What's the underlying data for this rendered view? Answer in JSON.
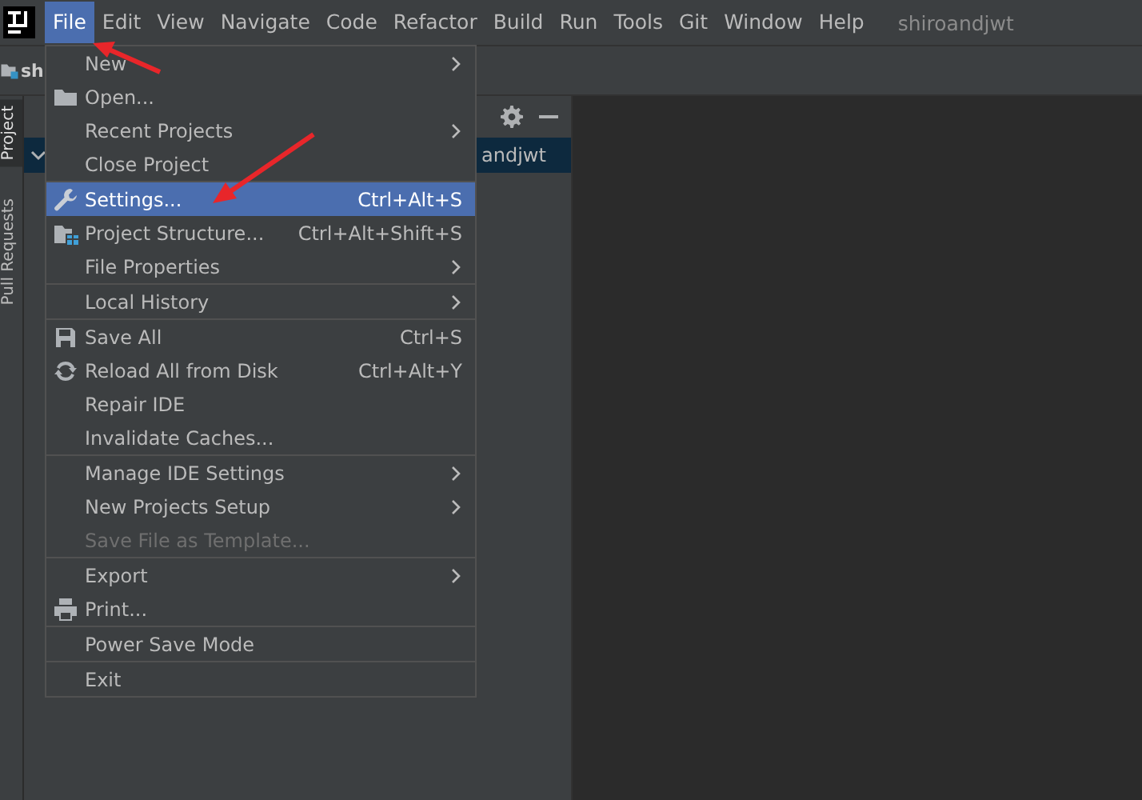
{
  "menubar": {
    "items": [
      {
        "label": "File",
        "selected": true
      },
      {
        "label": "Edit",
        "selected": false
      },
      {
        "label": "View",
        "selected": false
      },
      {
        "label": "Navigate",
        "selected": false
      },
      {
        "label": "Code",
        "selected": false
      },
      {
        "label": "Refactor",
        "selected": false
      },
      {
        "label": "Build",
        "selected": false
      },
      {
        "label": "Run",
        "selected": false
      },
      {
        "label": "Tools",
        "selected": false
      },
      {
        "label": "Git",
        "selected": false
      },
      {
        "label": "Window",
        "selected": false
      },
      {
        "label": "Help",
        "selected": false
      }
    ],
    "project_title": "shiroandjwt"
  },
  "tool_strip": [
    {
      "label": "Project",
      "selected": true
    },
    {
      "label": "Pull Requests",
      "selected": false
    }
  ],
  "breadcrumb": "sh",
  "project_tree": {
    "rows": [
      {
        "label": "andjwt",
        "expanded": true,
        "selected": true
      }
    ]
  },
  "file_menu": {
    "groups": [
      [
        {
          "label": "New",
          "kind": "plain",
          "submenu": true,
          "selected": false,
          "disabled": false
        },
        {
          "label": "Open...",
          "kind": "open",
          "submenu": false,
          "selected": false,
          "disabled": false
        },
        {
          "label": "Recent Projects",
          "kind": "plain",
          "submenu": true,
          "selected": false,
          "disabled": false
        },
        {
          "label": "Close Project",
          "kind": "plain",
          "submenu": false,
          "selected": false,
          "disabled": false
        }
      ],
      [
        {
          "label": "Settings...",
          "kind": "settings",
          "shortcut": "Ctrl+Alt+S",
          "submenu": false,
          "selected": true,
          "disabled": false
        },
        {
          "label": "Project Structure...",
          "kind": "structure",
          "shortcut": "Ctrl+Alt+Shift+S",
          "submenu": false,
          "selected": false,
          "disabled": false
        },
        {
          "label": "File Properties",
          "kind": "plain",
          "submenu": true,
          "selected": false,
          "disabled": false
        }
      ],
      [
        {
          "label": "Local History",
          "kind": "plain",
          "submenu": true,
          "selected": false,
          "disabled": false
        }
      ],
      [
        {
          "label": "Save All",
          "kind": "save",
          "shortcut": "Ctrl+S",
          "submenu": false,
          "selected": false,
          "disabled": false
        },
        {
          "label": "Reload All from Disk",
          "kind": "reload",
          "shortcut": "Ctrl+Alt+Y",
          "submenu": false,
          "selected": false,
          "disabled": false
        },
        {
          "label": "Repair IDE",
          "kind": "plain",
          "submenu": false,
          "selected": false,
          "disabled": false
        },
        {
          "label": "Invalidate Caches...",
          "kind": "plain",
          "submenu": false,
          "selected": false,
          "disabled": false
        }
      ],
      [
        {
          "label": "Manage IDE Settings",
          "kind": "plain",
          "submenu": true,
          "selected": false,
          "disabled": false
        },
        {
          "label": "New Projects Setup",
          "kind": "plain",
          "submenu": true,
          "selected": false,
          "disabled": false
        },
        {
          "label": "Save File as Template...",
          "kind": "plain",
          "submenu": false,
          "selected": false,
          "disabled": true
        }
      ],
      [
        {
          "label": "Export",
          "kind": "plain",
          "submenu": true,
          "selected": false,
          "disabled": false
        },
        {
          "label": "Print...",
          "kind": "print",
          "submenu": false,
          "selected": false,
          "disabled": false
        }
      ],
      [
        {
          "label": "Power Save Mode",
          "kind": "plain",
          "submenu": false,
          "selected": false,
          "disabled": false
        }
      ],
      [
        {
          "label": "Exit",
          "kind": "plain",
          "submenu": false,
          "selected": false,
          "disabled": false
        }
      ]
    ]
  }
}
